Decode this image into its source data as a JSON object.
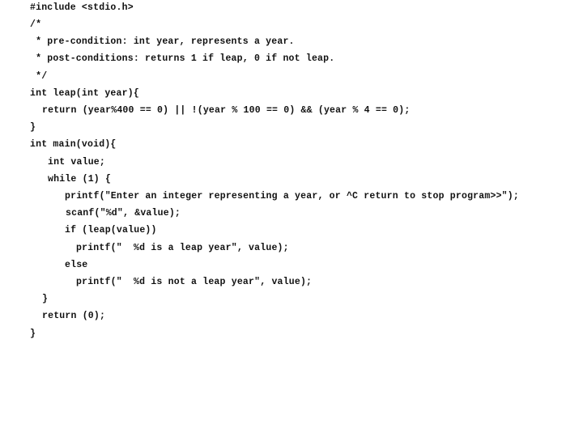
{
  "document": {
    "language": "C",
    "lines": [
      {
        "text": "#include <stdio.h>",
        "indent": 0
      },
      {
        "text": "/*",
        "indent": 0
      },
      {
        "text": " * pre-condition: int year, represents a year.",
        "indent": 0
      },
      {
        "text": " * post-conditions: returns 1 if leap, 0 if not leap.",
        "indent": 0
      },
      {
        "text": " */",
        "indent": 0
      },
      {
        "text": "int leap(int year){",
        "indent": 0
      },
      {
        "text": "return (year%400 == 0) || !(year % 100 == 0) && (year % 4 == 0);",
        "indent": 1
      },
      {
        "text": "}",
        "indent": 0
      },
      {
        "text": "int main(void){",
        "indent": 0
      },
      {
        "text": "int value;",
        "indent": 2
      },
      {
        "text": "while (1) {",
        "indent": 2
      },
      {
        "text": "printf(\"Enter an integer representing a year, or ^C return to stop program>>\");",
        "indent": 3
      },
      {
        "text": "scanf(\"%d\", &value);",
        "indent": 3
      },
      {
        "text": "if (leap(value))",
        "indent": 3
      },
      {
        "text": "printf(\"  %d is a leap year\", value);",
        "indent": 4
      },
      {
        "text": "else",
        "indent": 3
      },
      {
        "text": "printf(\"  %d is not a leap year\", value);",
        "indent": 4
      },
      {
        "text": "}",
        "indent": 1
      },
      {
        "text": "return (0);",
        "indent": 1
      },
      {
        "text": "}",
        "indent": 0
      }
    ]
  }
}
